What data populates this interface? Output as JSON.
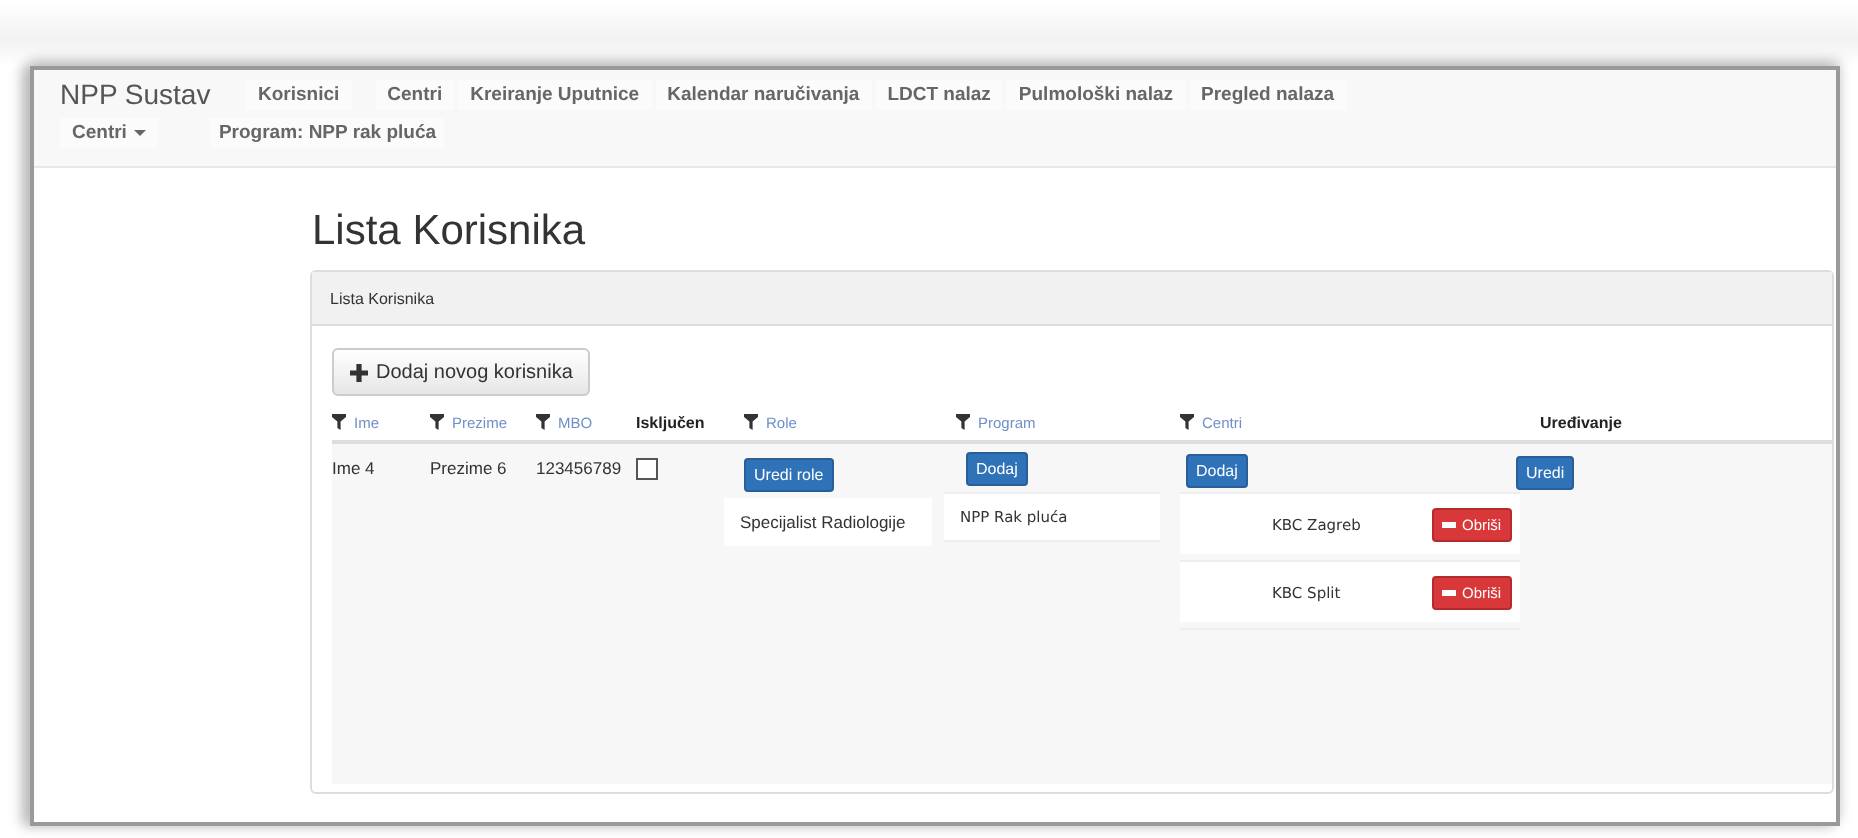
{
  "app": {
    "brand": "NPP Sustav",
    "nav": [
      {
        "label": "Korisnici"
      },
      {
        "label": "Centri"
      },
      {
        "label": "Kreiranje Uputnice"
      },
      {
        "label": "Kalendar naručivanja"
      },
      {
        "label": "LDCT nalaz"
      },
      {
        "label": "Pulmološki nalaz"
      },
      {
        "label": "Pregled nalaza"
      }
    ],
    "dropdown": "Centri",
    "program_label": "Program: NPP rak pluća"
  },
  "page_title": "Lista Korisnika",
  "panel": {
    "heading": "Lista Korisnika",
    "add_button": "Dodaj novog korisnika",
    "columns": [
      {
        "label": "Ime",
        "kind": "filter"
      },
      {
        "label": "Prezime",
        "kind": "filter"
      },
      {
        "label": "MBO",
        "kind": "filter"
      },
      {
        "label": "Isključen",
        "kind": "plain"
      },
      {
        "label": "Role",
        "kind": "filter"
      },
      {
        "label": "Program",
        "kind": "filter"
      },
      {
        "label": "Centri",
        "kind": "filter"
      },
      {
        "label": "Uređivanje",
        "kind": "plain"
      }
    ],
    "rows": [
      {
        "ime": "Ime 4",
        "prezime": "Prezime 6",
        "mbo": "123456789",
        "iskljucen": false,
        "roles_button": "Uredi role",
        "roles": [
          "Specijalist Radiologije"
        ],
        "program_button": "Dodaj",
        "programs": [
          "NPP Rak pluća"
        ],
        "centri_button": "Dodaj",
        "centri": [
          {
            "name": "KBC Zagreb",
            "remove": "Obriši"
          },
          {
            "name": "KBC Split",
            "remove": "Obriši"
          }
        ],
        "edit_button": "Uredi"
      }
    ]
  }
}
